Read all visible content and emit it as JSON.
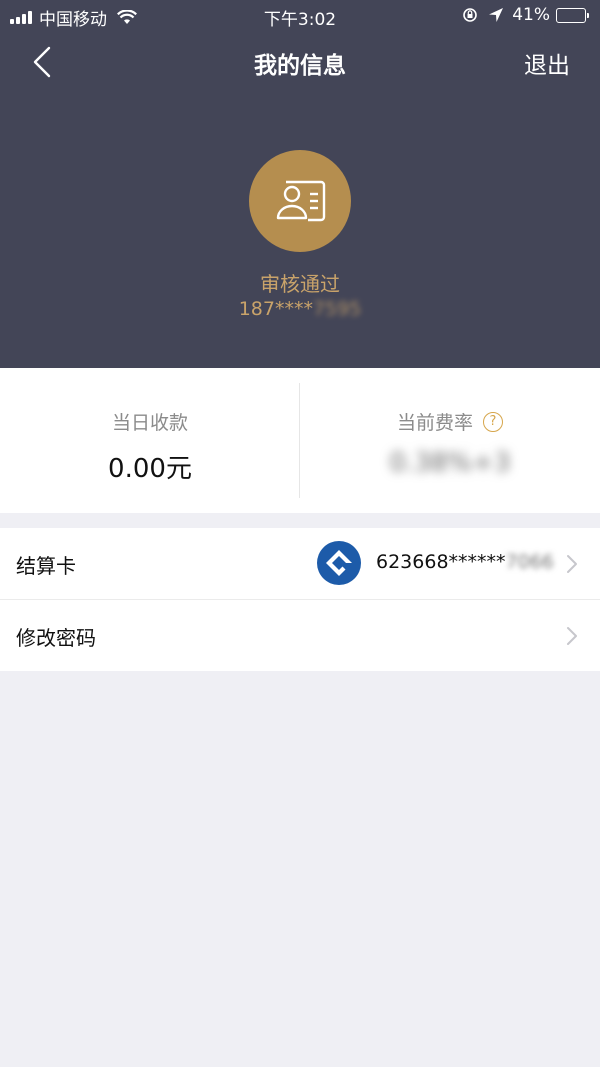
{
  "status_bar": {
    "carrier": "中国移动",
    "time": "下午3:02",
    "battery": "41%",
    "battery_level": 0.41,
    "battery_color": "#f5c518"
  },
  "nav": {
    "title": "我的信息",
    "logout": "退出"
  },
  "profile": {
    "status": "审核通过",
    "phone_prefix": "187****",
    "phone_suffix_blurred": "7595",
    "avatar_color": "#b58e4f"
  },
  "stats": {
    "today_label": "当日收款",
    "today_value": "0.00元",
    "rate_label": "当前费率",
    "rate_help": "?",
    "rate_value_blurred": "0.38%+3"
  },
  "list": {
    "card_label": "结算卡",
    "card_prefix": "623668******",
    "card_suffix_blurred": "7066",
    "password_label": "修改密码"
  },
  "colors": {
    "header_bg": "#434557",
    "accent_gold": "#c9a36a",
    "bank_blue": "#1d5ba9"
  },
  "icons": [
    "back-icon",
    "id-card-icon",
    "help-icon",
    "bank-logo-icon",
    "chevron-right-icon",
    "wifi-icon",
    "signal-icon",
    "battery-icon",
    "location-icon",
    "rotation-lock-icon"
  ]
}
